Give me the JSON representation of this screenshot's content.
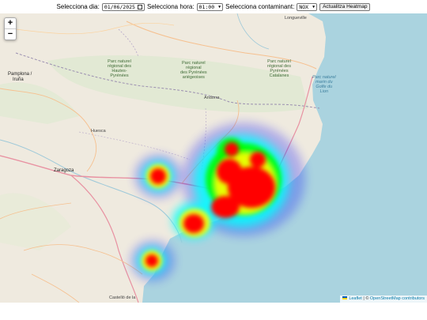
{
  "controls": {
    "date_label": "Selecciona dia:",
    "date_value": "01/06/2025",
    "hour_label": "Selecciona hora:",
    "hour_value": "01:00",
    "pollutant_label": "Selecciona contaminant:",
    "pollutant_value": "NOX",
    "update_button": "Actualitza Heatmap"
  },
  "zoom": {
    "in": "+",
    "out": "−"
  },
  "attribution": {
    "leaflet": "Leaflet",
    "separator": " | © ",
    "osm": "OpenStreetMap contributors"
  },
  "map_labels": {
    "longueville": "Longueville",
    "pamplona": "Pamplona /",
    "irunea": "Iruña",
    "zaragoza": "Zaragoza",
    "huesca": "Huesca",
    "andorra": "Andorra",
    "park_pyrenees": "Parc naturel\nrégional\ndes Pyrénées\nariégeoises",
    "park_catalanes": "Parc naturel\nrégional des\nPyrénées\nCatalanes",
    "park_hautes": "Parc naturel\nrégional des\nHautes-\nPyrénées",
    "park_golfe": "Parc naturel\nmarin du\nGolfe du\nLion",
    "castello": "Castelló de la"
  },
  "heatmap": {
    "gradient": [
      "#0000ff",
      "#00ffff",
      "#00ff00",
      "#ffff00",
      "#ff0000"
    ]
  }
}
